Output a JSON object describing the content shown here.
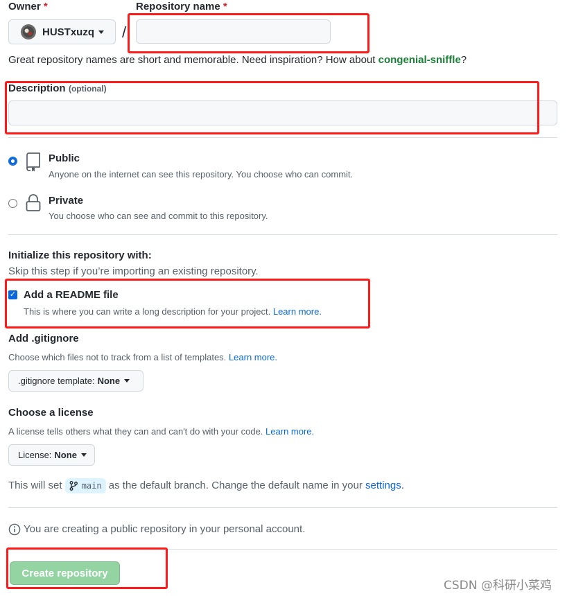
{
  "owner": {
    "label": "Owner",
    "required_mark": "*",
    "value": "HUSTxuzq"
  },
  "separator": "/",
  "repo_name": {
    "label": "Repository name",
    "required_mark": "*",
    "value": ""
  },
  "hint": {
    "prefix": "Great repository names are short and memorable. Need inspiration? How about ",
    "suggestion": "congenial-sniffle",
    "suffix": "?"
  },
  "description": {
    "label": "Description",
    "optional": "(optional)",
    "value": ""
  },
  "visibility": {
    "selected": "public",
    "public": {
      "title": "Public",
      "desc": "Anyone on the internet can see this repository. You choose who can commit."
    },
    "private": {
      "title": "Private",
      "desc": "You choose who can see and commit to this repository."
    }
  },
  "init": {
    "title": "Initialize this repository with:",
    "subtitle": "Skip this step if you’re importing an existing repository.",
    "readme": {
      "checked": true,
      "label": "Add a README file",
      "desc": "This is where you can write a long description for your project.",
      "link": "Learn more."
    }
  },
  "gitignore": {
    "title": "Add .gitignore",
    "desc": "Choose which files not to track from a list of templates.",
    "link": "Learn more.",
    "button_label": ".gitignore template:",
    "button_value": "None"
  },
  "license": {
    "title": "Choose a license",
    "desc": "A license tells others what they can and can't do with your code.",
    "link": "Learn more.",
    "button_label": "License:",
    "button_value": "None"
  },
  "branch": {
    "prefix": "This will set",
    "name": "main",
    "middle": "as the default branch. Change the default name in your",
    "link": "settings",
    "suffix": "."
  },
  "info": "You are creating a public repository in your personal account.",
  "create_button": "Create repository",
  "watermark": "CSDN @科研小菜鸡",
  "colors": {
    "highlight_box": "#ff1a1a",
    "link": "#0969da",
    "create_button": "#94d3a2",
    "suggestion": "#1a7f37"
  }
}
